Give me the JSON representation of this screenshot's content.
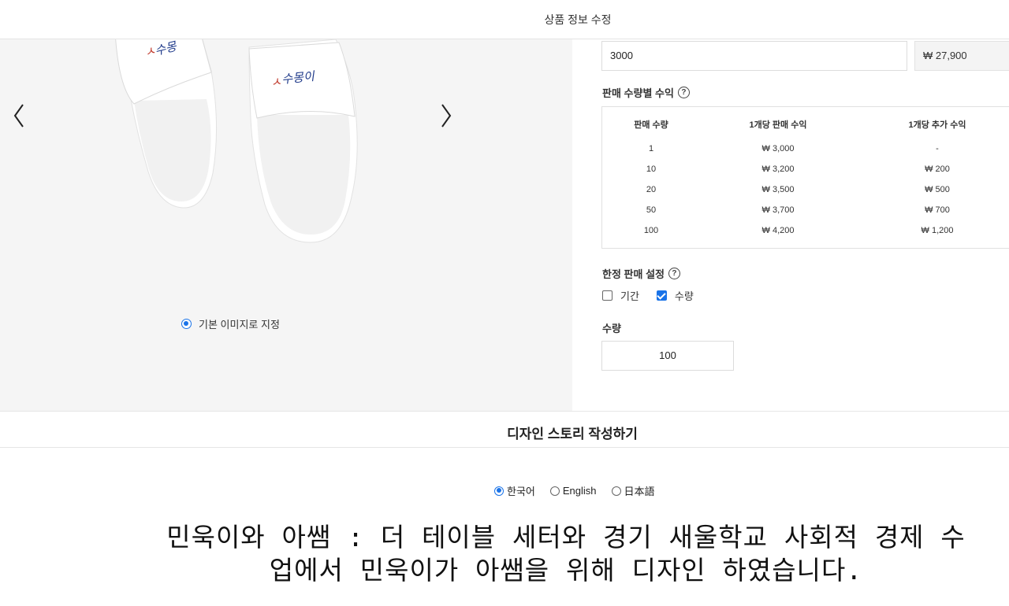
{
  "header": {
    "title": "상품 정보 수정"
  },
  "gallery": {
    "default_image_label": "기본 이미지로 지정"
  },
  "pricing": {
    "price_input_value": "3000",
    "total_price": "₩ 27,900"
  },
  "profit_table": {
    "label": "판매 수량별 수익",
    "headers": [
      "판매 수량",
      "1개당 판매 수익",
      "1개당 추가 수익"
    ],
    "rows": [
      [
        "1",
        "₩ 3,000",
        "-"
      ],
      [
        "10",
        "₩ 3,200",
        "₩ 200"
      ],
      [
        "20",
        "₩ 3,500",
        "₩ 500"
      ],
      [
        "50",
        "₩ 3,700",
        "₩ 700"
      ],
      [
        "100",
        "₩ 4,200",
        "₩ 1,200"
      ]
    ]
  },
  "limited_sale": {
    "label": "한정 판매 설정",
    "period_label": "기간",
    "period_checked": false,
    "quantity_label": "수량",
    "quantity_checked": true
  },
  "quantity": {
    "label": "수량",
    "value": "100"
  },
  "story": {
    "title": "디자인 스토리 작성하기",
    "languages": [
      "한국어",
      "English",
      "日本語"
    ],
    "selected_language": "한국어",
    "text": "민욱이와 아쌤 : 더 테이블 세터와 경기 새울학교 사회적 경제 수업에서 민욱이가 아쌤을 위해 디자인 하였습니다."
  },
  "colors": {
    "accent": "#1a73e8",
    "gallery_bg": "#f5f5f5"
  }
}
